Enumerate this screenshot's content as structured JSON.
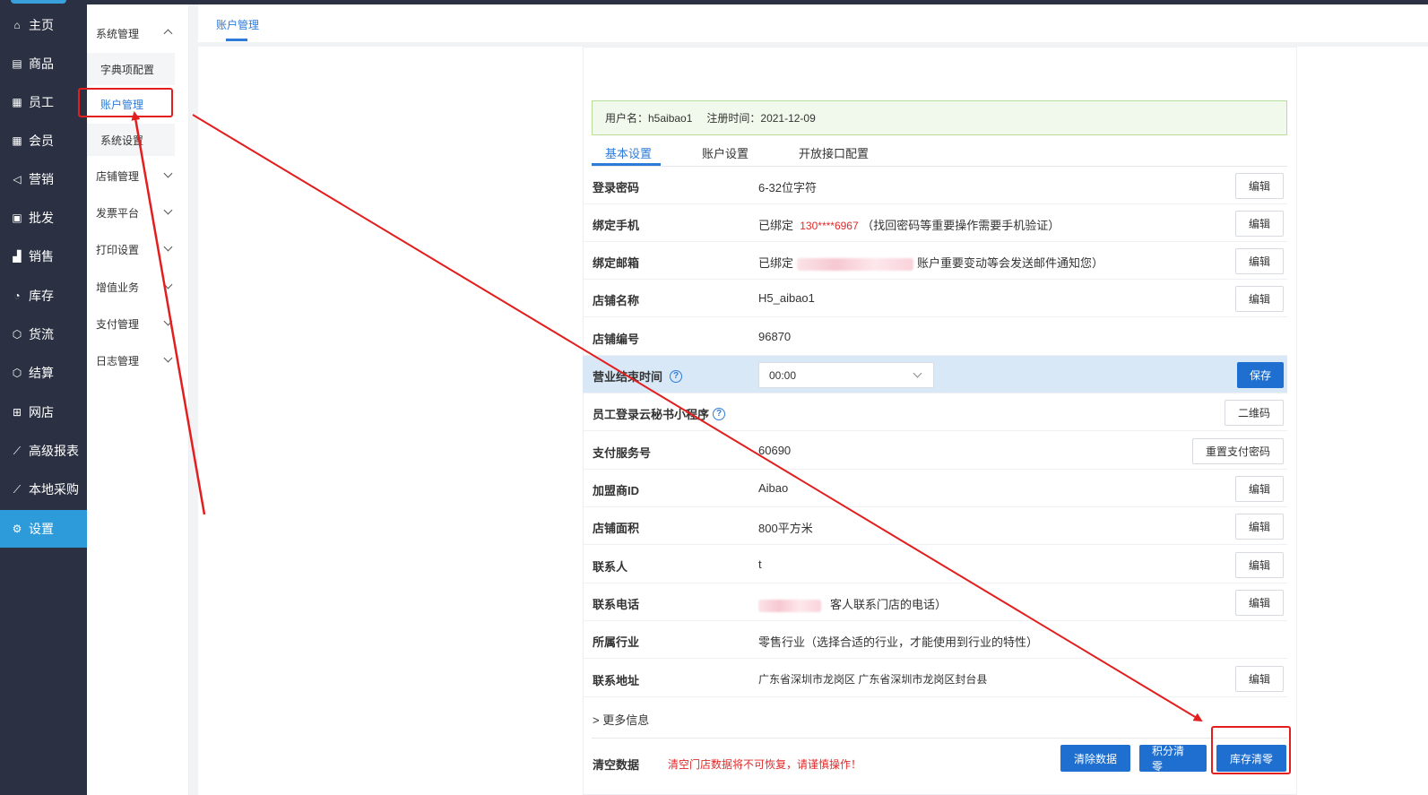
{
  "nav": {
    "items": [
      {
        "label": "主页",
        "icon": "home-icon"
      },
      {
        "label": "商品",
        "icon": "goods-icon"
      },
      {
        "label": "员工",
        "icon": "staff-icon"
      },
      {
        "label": "会员",
        "icon": "member-icon"
      },
      {
        "label": "营销",
        "icon": "megaphone-icon"
      },
      {
        "label": "批发",
        "icon": "list-icon"
      },
      {
        "label": "销售",
        "icon": "bar-chart-icon"
      },
      {
        "label": "库存",
        "icon": "pie-chart-icon"
      },
      {
        "label": "货流",
        "icon": "cube-icon"
      },
      {
        "label": "结算",
        "icon": "settle-icon"
      },
      {
        "label": "网店",
        "icon": "shop-icon"
      },
      {
        "label": "高级报表",
        "icon": "line-chart-icon"
      },
      {
        "label": "本地采购",
        "icon": "line-chart-icon"
      },
      {
        "label": "设置",
        "icon": "gear-icon"
      }
    ]
  },
  "submenu": {
    "system_group": "系统管理",
    "dict_config": "字典项配置",
    "account_mgmt": "账户管理",
    "system_settings": "系统设置",
    "groups": [
      "店铺管理",
      "发票平台",
      "打印设置",
      "增值业务",
      "支付管理",
      "日志管理"
    ]
  },
  "tabbar": {
    "active_tab": "账户管理"
  },
  "info_bar": {
    "username_label": "用户名：h5aibao1",
    "reg_time_label": "注册时间：2021-12-09"
  },
  "inner_tabs": [
    "基本设置",
    "账户设置",
    "开放接口配置"
  ],
  "rows": {
    "password": {
      "label": "登录密码",
      "value": "6-32位字符",
      "button": "编辑"
    },
    "phone": {
      "label": "绑定手机",
      "prefix": "已绑定",
      "number": "130****6967",
      "suffix": "（找回密码等重要操作需要手机验证）",
      "button": "编辑"
    },
    "email": {
      "label": "绑定邮箱",
      "prefix": "已绑定",
      "suffix": "账户重要变动等会发送邮件通知您）",
      "button": "编辑"
    },
    "shop_name": {
      "label": "店铺名称",
      "value": "H5_aibao1",
      "button": "编辑"
    },
    "shop_no": {
      "label": "店铺编号",
      "value": "96870"
    },
    "close_time": {
      "label": "营业结束时间",
      "value": "00:00",
      "button": "保存"
    },
    "mini_program": {
      "label": "员工登录云秘书小程序",
      "button": "二维码"
    },
    "pay_no": {
      "label": "支付服务号",
      "value": "60690",
      "button": "重置支付密码"
    },
    "franchise": {
      "label": "加盟商ID",
      "value": "Aibao",
      "button": "编辑"
    },
    "area": {
      "label": "店铺面积",
      "value": "800平方米",
      "button": "编辑"
    },
    "contact": {
      "label": "联系人",
      "value": "t",
      "button": "编辑"
    },
    "contact_phone": {
      "label": "联系电话",
      "suffix": "客人联系门店的电话）",
      "button": "编辑"
    },
    "industry": {
      "label": "所属行业",
      "value": "零售行业（选择合适的行业，才能使用到行业的特性）"
    },
    "address": {
      "label": "联系地址",
      "value": "广东省深圳市龙岗区 广东省深圳市龙岗区封台县",
      "button": "编辑"
    }
  },
  "more": "更多信息",
  "clear": {
    "label": "清空数据",
    "warning": "清空门店数据将不可恢复，请谨慎操作！",
    "btn_clear": "清除数据",
    "btn_points": "积分清零",
    "btn_stock": "库存清零"
  },
  "colors": {
    "nav_bg": "#2b3142",
    "nav_active": "#2d9bd9",
    "primary": "#1e6fd0",
    "annotation": "#e21e1e"
  }
}
